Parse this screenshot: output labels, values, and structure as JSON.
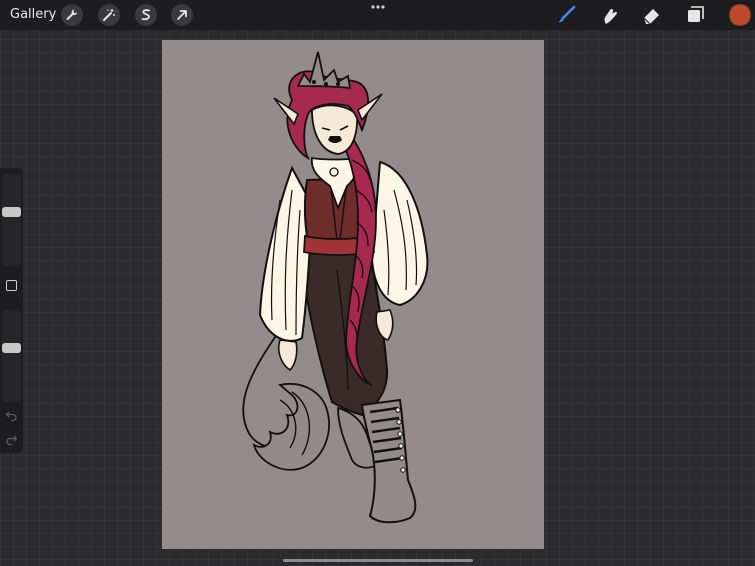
{
  "topbar": {
    "gallery_label": "Gallery",
    "left_tools": [
      "wrench-icon",
      "magic-wand-icon",
      "selection-icon",
      "transform-arrow-icon"
    ],
    "more_icon": "ellipsis-icon",
    "right_tools": [
      "brush-icon",
      "smudge-icon",
      "eraser-icon",
      "layers-icon"
    ],
    "active_tool": "brush-icon",
    "current_color": "#c24a2c",
    "accent_color": "#3d8df0"
  },
  "sidebar": {
    "brush_size_level": 0.35,
    "opacity_level": 0.35,
    "modify_icon": "square-icon",
    "undo_icon": "undo-icon",
    "redo_icon": "redo-icon"
  },
  "canvas": {
    "background_color": "#938b8c",
    "artwork": "character-illustration"
  }
}
